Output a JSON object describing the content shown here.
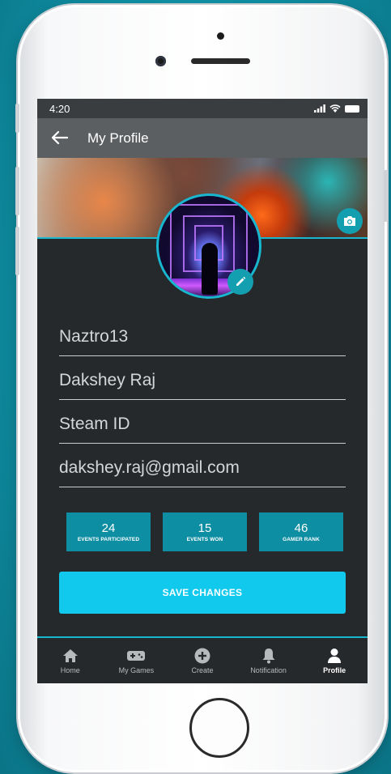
{
  "status_bar": {
    "time": "4:20",
    "signal": "signal-icon",
    "wifi": "wifi-icon",
    "battery": "battery-icon"
  },
  "app_bar": {
    "title": "My Profile",
    "back_icon": "arrow-left-icon"
  },
  "banner": {
    "camera_icon": "camera-icon"
  },
  "avatar": {
    "edit_icon": "pencil-icon"
  },
  "fields": {
    "username": "Naztro13",
    "full_name": "Dakshey Raj",
    "steam_id_placeholder": "Steam ID",
    "email": "dakshey.raj@gmail.com"
  },
  "stats": [
    {
      "value": "24",
      "label": "EVENTS PARTICIPATED"
    },
    {
      "value": "15",
      "label": "EVENTS WON"
    },
    {
      "value": "46",
      "label": "GAMER RANK"
    }
  ],
  "save_button": {
    "label": "SAVE CHANGES"
  },
  "bottom_nav": [
    {
      "label": "Home",
      "icon": "home-icon",
      "active": false
    },
    {
      "label": "My Games",
      "icon": "gamepad-icon",
      "active": false
    },
    {
      "label": "Create",
      "icon": "plus-circle-icon",
      "active": false
    },
    {
      "label": "Notification",
      "icon": "bell-icon",
      "active": false
    },
    {
      "label": "Profile",
      "icon": "person-icon",
      "active": true
    }
  ],
  "colors": {
    "accent": "#19b7cf",
    "button": "#11c9ec",
    "stat_bg": "#0e8ea3",
    "screen_bg": "#26292c"
  }
}
